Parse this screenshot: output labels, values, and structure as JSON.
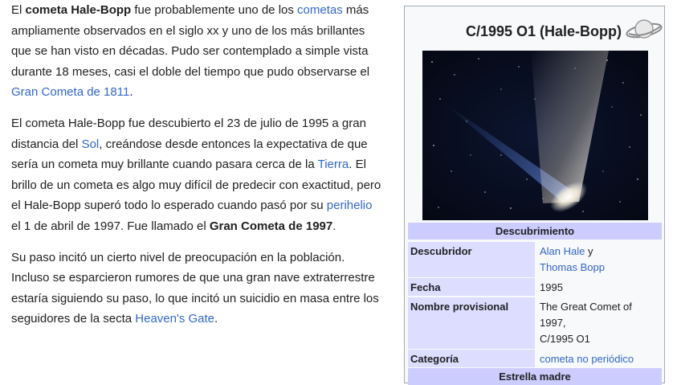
{
  "article": {
    "p1": {
      "t1": "El ",
      "b1": "cometa Hale-Bopp",
      "t2": " fue probablemente uno de los ",
      "l1": "cometas",
      "t3": " más ampliamente observados en el siglo xx y uno de los más brillantes que se han visto en décadas. Pudo ser contemplado a simple vista durante 18 meses, casi el doble del tiempo que pudo observarse el ",
      "l2": "Gran Cometa de 1811",
      "t4": "."
    },
    "p2": {
      "t1": "El cometa Hale-Bopp fue descubierto el 23 de julio de 1995 a gran distancia del ",
      "l1": "Sol",
      "t2": ", creándose desde entonces la expectativa de que sería un cometa muy brillante cuando pasara cerca de la ",
      "l2": "Tierra",
      "t3": ". El brillo de un cometa es algo muy difícil de predecir con exactitud, pero el Hale-Bopp superó todo lo esperado cuando pasó por su ",
      "l3": "perihelio",
      "t4": " el 1 de abril de 1997. Fue llamado el ",
      "b1": "Gran Cometa de 1997",
      "t5": "."
    },
    "p3": {
      "t1": "Su paso incitó un cierto nivel de preocupación en la población. Incluso se esparcieron rumores de que una gran nave extraterrestre estaría siguiendo su paso, lo que incitó un suicidio en masa entre los seguidores de la secta ",
      "l1": "Heaven's Gate",
      "t2": "."
    }
  },
  "infobox": {
    "title": "C/1995 O1 (Hale-Bopp)",
    "icon": "planet-ringed-icon",
    "section1": "Descubrimiento",
    "rows": {
      "descubridor": {
        "label": "Descubridor",
        "v1": "Alan Hale",
        "v_and": " y",
        "v2": "Thomas Bopp"
      },
      "fecha": {
        "label": "Fecha",
        "value": "1995"
      },
      "provisional": {
        "label": "Nombre provisional",
        "v1": "The Great Comet of 1997,",
        "v2": "C/1995 O1"
      },
      "categoria": {
        "label": "Categoría",
        "value": "cometa no periódico"
      }
    },
    "section2": "Estrella madre"
  },
  "colors": {
    "link": "#3366cc",
    "section_bg": "#ccccff",
    "label_bg": "#ddddff",
    "infobox_bg": "#f8f9fa",
    "border": "#a2a9b1"
  }
}
